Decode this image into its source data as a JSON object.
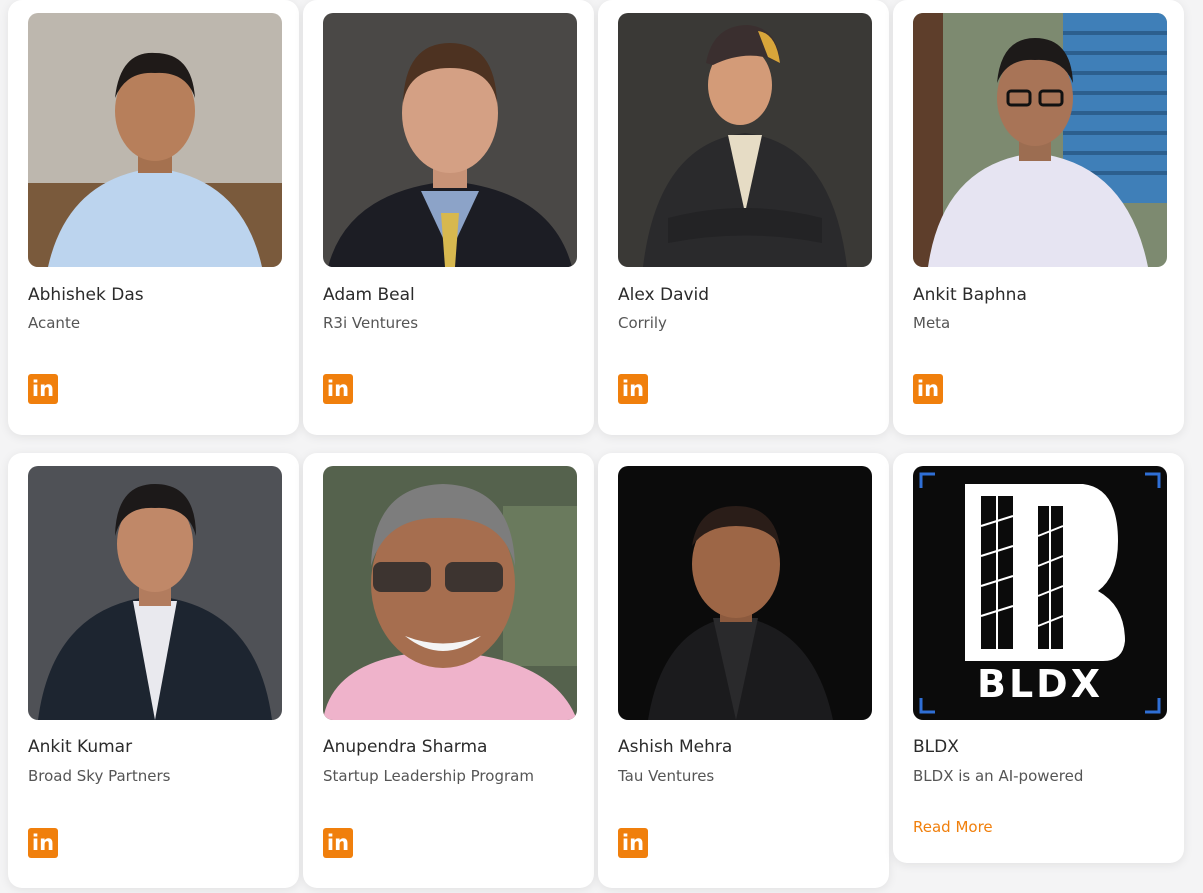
{
  "people": [
    {
      "name": "Abhishek Das",
      "company": "Acante",
      "icon": "linkedin-icon"
    },
    {
      "name": "Adam Beal",
      "company": "R3i Ventures",
      "icon": "linkedin-icon"
    },
    {
      "name": "Alex David",
      "company": "Corrily",
      "icon": "linkedin-icon"
    },
    {
      "name": "Ankit Baphna",
      "company": "Meta",
      "icon": "linkedin-icon"
    },
    {
      "name": "Ankit Kumar",
      "company": "Broad Sky Partners",
      "icon": "linkedin-icon"
    },
    {
      "name": "Anupendra Sharma",
      "company": "Startup Leadership Program",
      "icon": "linkedin-icon"
    },
    {
      "name": "Ashish Mehra",
      "company": "Tau Ventures",
      "icon": "linkedin-icon"
    },
    {
      "name": "BLDX",
      "company": "BLDX is an AI-powered",
      "read_more": "Read More",
      "logo_text": "BLDX"
    }
  ],
  "linkedin_label": "in",
  "colors": {
    "accent": "#f07f0c",
    "card_bg": "#ffffff",
    "page_bg": "#f4f4f5",
    "logo_bg": "#0b0b0b",
    "logo_x": "#2f6fd6"
  }
}
